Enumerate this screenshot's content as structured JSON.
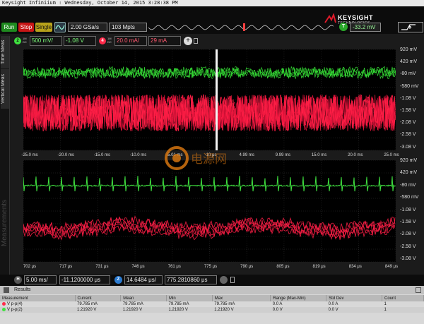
{
  "window": {
    "title": "Keysight Infiniium : Wednesday, October 14, 2015 3:28:38 PM"
  },
  "brand": {
    "name": "KEYSIGHT",
    "sub": "TECHNOLOGIES"
  },
  "toolbar": {
    "run_label": "Run",
    "stop_label": "Stop",
    "single_label": "Single",
    "sample_rate": "2.00 GSa/s",
    "memory_depth": "103 Mpts",
    "trigger_badge": "T",
    "trigger_level": "-33.2 mV"
  },
  "channels": {
    "ch2": {
      "badge": "2",
      "sub_top": "1M",
      "sub_bot": "DC",
      "scale": "500 mV/",
      "offset": "-1.08 V",
      "color": "#3fe03f"
    },
    "ch4": {
      "badge": "4",
      "sub_top": "1M",
      "sub_bot": "DC",
      "scale": "20.0 mA/",
      "offset": "29 mA",
      "color": "#ff2a4a"
    },
    "add_icon": "plus-icon"
  },
  "side_tabs": {
    "time": "Time Meas",
    "vertical": "Vertical Meas",
    "measurements": "Measurements"
  },
  "top_plot": {
    "y_labels": [
      "920 mV",
      "420 mV",
      "-80 mV",
      "-580 mV",
      "-1.08 V",
      "-1.58 V",
      "-2.08 V",
      "-2.58 V",
      "-3.08 V"
    ],
    "x_labels": [
      "-25.0 ms",
      "-20.0 ms",
      "-15.0 ms",
      "-10.0 ms",
      "-5.01 ms",
      "-10 μs",
      "4.99 ms",
      "9.99 ms",
      "15.0 ms",
      "20.0 ms",
      "25.0 ms"
    ]
  },
  "bottom_plot": {
    "y_labels": [
      "920 mV",
      "420 mV",
      "-80 mV",
      "-580 mV",
      "-1.08 V",
      "-1.58 V",
      "-2.08 V",
      "-2.58 V",
      "-3.08 V"
    ],
    "x_labels": [
      "702 μs",
      "717 μs",
      "731 μs",
      "746 μs",
      "761 μs",
      "775 μs",
      "790 μs",
      "805 μs",
      "819 μs",
      "834 μs",
      "849 μs"
    ]
  },
  "watermark": {
    "text": "电源网"
  },
  "horizontal": {
    "badge": "H",
    "scale": "5.00 ms/",
    "position": "-11.1200000 μs",
    "zoom_badge": "Z",
    "zoom_scale": "14.6484 μs/",
    "zoom_position": "775.2810860 μs"
  },
  "results": {
    "title": "Results",
    "columns": [
      "Measurement",
      "Current",
      "Mean",
      "Min",
      "Max",
      "Range (Max-Min)",
      "Std Dev",
      "Count"
    ],
    "rows": [
      {
        "color": "#ff2a4a",
        "cells": [
          "V p-p(4)",
          "79.785 mA",
          "79.785 mA",
          "79.785 mA",
          "79.785 mA",
          "0.0 A",
          "0.0 A",
          "1"
        ]
      },
      {
        "color": "#3fe03f",
        "cells": [
          "V p-p(2)",
          "1.21920 V",
          "1.21920 V",
          "1.21920 V",
          "1.21920 V",
          "0.0 V",
          "0.0 V",
          "1"
        ]
      }
    ]
  }
}
